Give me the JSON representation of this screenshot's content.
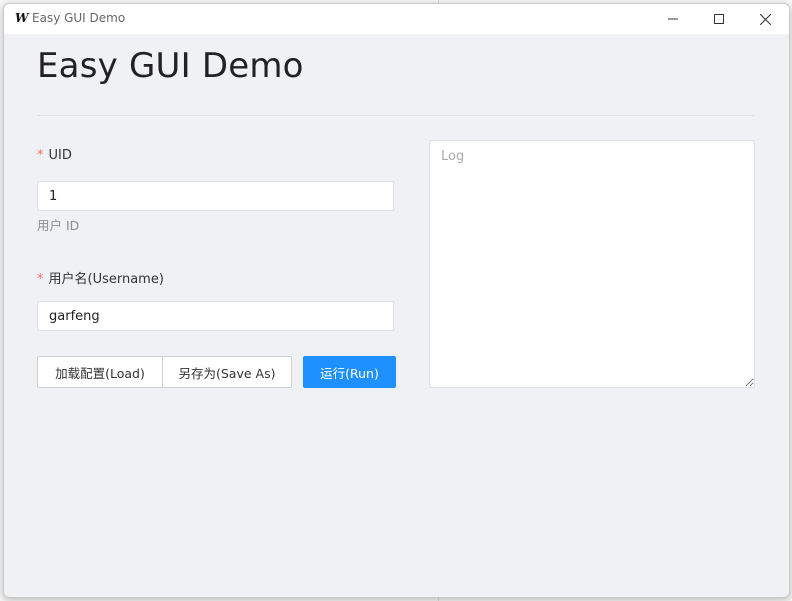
{
  "window": {
    "title": "Easy GUI Demo",
    "icon_glyph": "W"
  },
  "page": {
    "title": "Easy GUI Demo"
  },
  "form": {
    "uid": {
      "required_mark": "*",
      "label": "UID",
      "value": "1",
      "hint": "用户 ID"
    },
    "username": {
      "required_mark": "*",
      "label": "用户名(Username)",
      "value": "garfeng"
    }
  },
  "buttons": {
    "load": "加载配置(Load)",
    "save_as": "另存为(Save As)",
    "run": "运行(Run)"
  },
  "log": {
    "placeholder": "Log",
    "value": ""
  },
  "colors": {
    "primary": "#1e90ff",
    "required": "#f56c6c"
  },
  "icons": {
    "minimize": "minimize-icon",
    "maximize": "maximize-icon",
    "close": "close-icon"
  }
}
